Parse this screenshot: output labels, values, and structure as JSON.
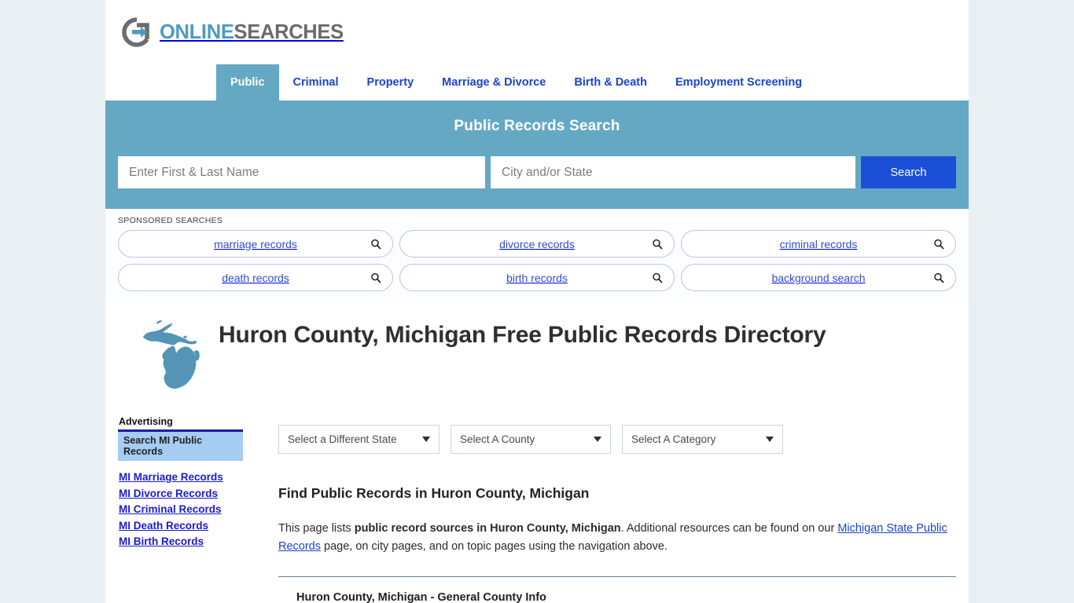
{
  "brand": {
    "logo_icon": "circle-arrow-logo-icon",
    "name_primary": "ONLINE",
    "name_secondary": "SEARCHES"
  },
  "nav": {
    "items": [
      {
        "label": "Public",
        "active": true
      },
      {
        "label": "Criminal",
        "active": false
      },
      {
        "label": "Property",
        "active": false
      },
      {
        "label": "Marriage & Divorce",
        "active": false
      },
      {
        "label": "Birth & Death",
        "active": false
      },
      {
        "label": "Employment Screening",
        "active": false
      }
    ]
  },
  "hero": {
    "title": "Public Records Search",
    "name_placeholder": "Enter First & Last Name",
    "name_value": "",
    "city_placeholder": "City and/or State",
    "city_value": "",
    "search_button": "Search",
    "background_color": "#64a8c4",
    "button_color": "#1b4fd8"
  },
  "sponsored": {
    "label": "SPONSORED SEARCHES",
    "pills": [
      {
        "label": "marriage records",
        "icon": "search-icon"
      },
      {
        "label": "divorce records",
        "icon": "search-icon"
      },
      {
        "label": "criminal records",
        "icon": "search-icon"
      },
      {
        "label": "death records",
        "icon": "search-icon"
      },
      {
        "label": "birth records",
        "icon": "search-icon"
      },
      {
        "label": "background search",
        "icon": "search-icon"
      }
    ]
  },
  "page": {
    "state_map_icon": "michigan-state-outline-icon",
    "title": "Huron County, Michigan Free Public Records Directory",
    "selects": [
      {
        "value": "Select a Different State"
      },
      {
        "value": "Select A County"
      },
      {
        "value": "Select A Category"
      }
    ],
    "section_heading": "Find Public Records in Huron County, Michigan",
    "paragraph": {
      "part1": "This page lists ",
      "bold1": "public record sources in Huron County, Michigan",
      "part2": ". Additional resources can be found on our ",
      "link": "Michigan State Public Records",
      "part3": " page, on city pages, and on topic pages using the navigation above."
    },
    "next_heading": "Huron County, Michigan - General County Info"
  },
  "sidebar": {
    "advertising_label": "Advertising",
    "ad_heading": "Search MI Public Records",
    "links": [
      {
        "label": "MI Marriage Records"
      },
      {
        "label": "MI Divorce Records"
      },
      {
        "label": "MI Criminal Records"
      },
      {
        "label": "MI Death Records"
      },
      {
        "label": "MI Birth Records"
      }
    ]
  }
}
